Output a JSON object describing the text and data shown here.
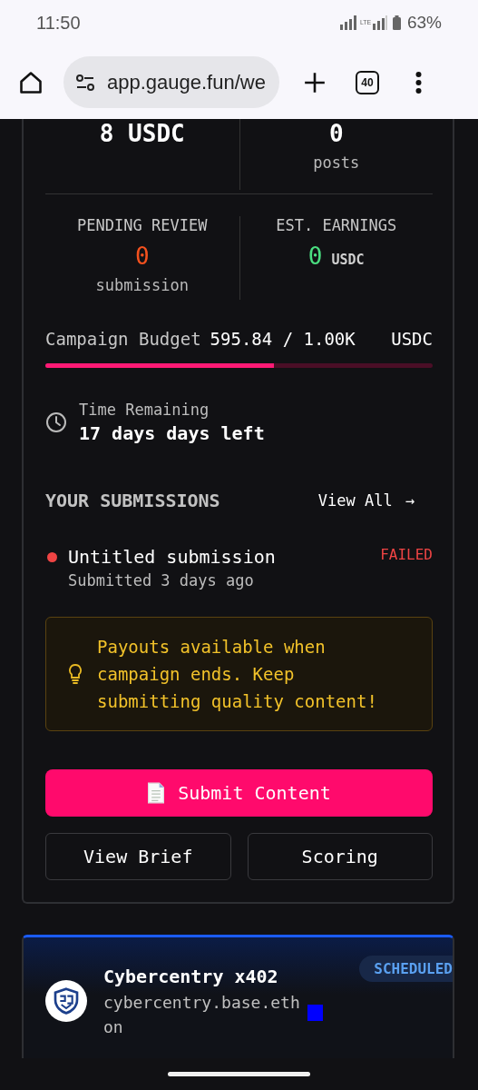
{
  "status_bar": {
    "time": "11:50",
    "network": "LTE",
    "battery": "63%"
  },
  "browser": {
    "url": "app.gauge.fun/we",
    "tab_count": "40"
  },
  "stats": [
    {
      "value": "8 USDC",
      "color": "#ffffff"
    },
    {
      "value": "0",
      "sub": "posts",
      "color": "#ffffff"
    },
    {
      "label": "PENDING REVIEW",
      "value": "0",
      "sub": "submission",
      "color": "#f4511e"
    },
    {
      "label": "EST. EARNINGS",
      "value": "0",
      "unit": "USDC",
      "color": "#4ade80"
    }
  ],
  "budget": {
    "label": "Campaign Budget",
    "amount": "595.84 / 1.00K",
    "unit": "USDC",
    "level": 0.59
  },
  "time_remaining": {
    "label": "Time Remaining",
    "value": "17 days days left"
  },
  "submissions": {
    "title": "YOUR SUBMISSIONS",
    "view_all": "View All",
    "view_all_arrow": "→",
    "items": [
      {
        "title": "Untitled submission",
        "meta": "Submitted 3 days ago",
        "status": "FAILED",
        "color": "#ef4444"
      }
    ]
  },
  "notice": "Payouts available when campaign ends. Keep submitting quality content!",
  "primary_button": "Submit Content",
  "buttons": [
    "View Brief",
    "Scoring"
  ],
  "next_campaign": {
    "name": "Cybercentry x402",
    "handle": "cybercentry.base.eth",
    "line": "on",
    "badge": "SCHEDULED"
  }
}
